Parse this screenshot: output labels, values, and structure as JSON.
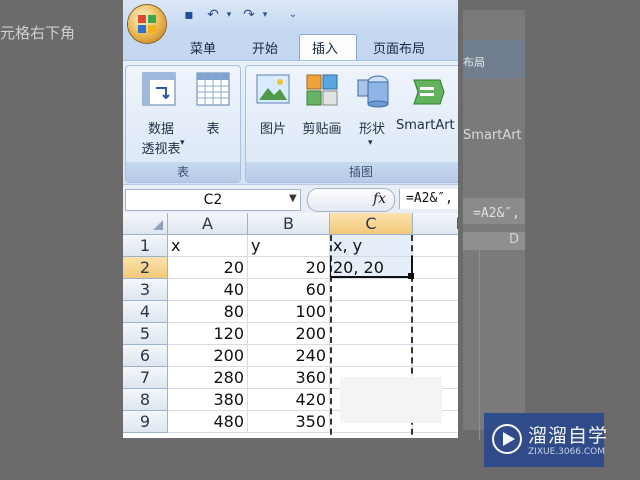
{
  "background": {
    "caption": "元格右下角",
    "ghost_smartart": "SmartArt",
    "ghost_formula": "=A2&″,",
    "ghost_tab": "布局",
    "ghost_col": "D"
  },
  "ribbon": {
    "tabs": [
      {
        "label": "菜单"
      },
      {
        "label": "开始"
      },
      {
        "label": "插入"
      },
      {
        "label": "页面布局"
      }
    ],
    "active_tab": "插入",
    "groups": {
      "table": {
        "label": "表",
        "pivot_label_line1": "数据",
        "pivot_label_line2": "透视表",
        "table_label": "表"
      },
      "illustrations": {
        "label": "插图",
        "picture_label": "图片",
        "clipart_label": "剪贴画",
        "shapes_label": "形状",
        "smartart_label": "SmartArt"
      }
    }
  },
  "formula_bar": {
    "name_box": "C2",
    "fx": "fx",
    "formula": "=A2&″, "
  },
  "sheet": {
    "columns": [
      "A",
      "B",
      "C",
      "D"
    ],
    "rows": [
      {
        "row": "1",
        "a": "x",
        "b": "y",
        "c": "x, y"
      },
      {
        "row": "2",
        "a": "20",
        "b": "20",
        "c": "20, 20"
      },
      {
        "row": "3",
        "a": "40",
        "b": "60",
        "c": ""
      },
      {
        "row": "4",
        "a": "80",
        "b": "100",
        "c": ""
      },
      {
        "row": "5",
        "a": "120",
        "b": "200",
        "c": ""
      },
      {
        "row": "6",
        "a": "200",
        "b": "240",
        "c": ""
      },
      {
        "row": "7",
        "a": "280",
        "b": "360",
        "c": ""
      },
      {
        "row": "8",
        "a": "380",
        "b": "420",
        "c": ""
      },
      {
        "row": "9",
        "a": "480",
        "b": "350",
        "c": ""
      }
    ],
    "active_cell": "C2",
    "colors": {
      "header_selected": "#f2c87a",
      "header": "#dfe6ef"
    }
  },
  "watermark": {
    "title": "溜溜自学",
    "url": "ZIXUE.3066.COM"
  }
}
